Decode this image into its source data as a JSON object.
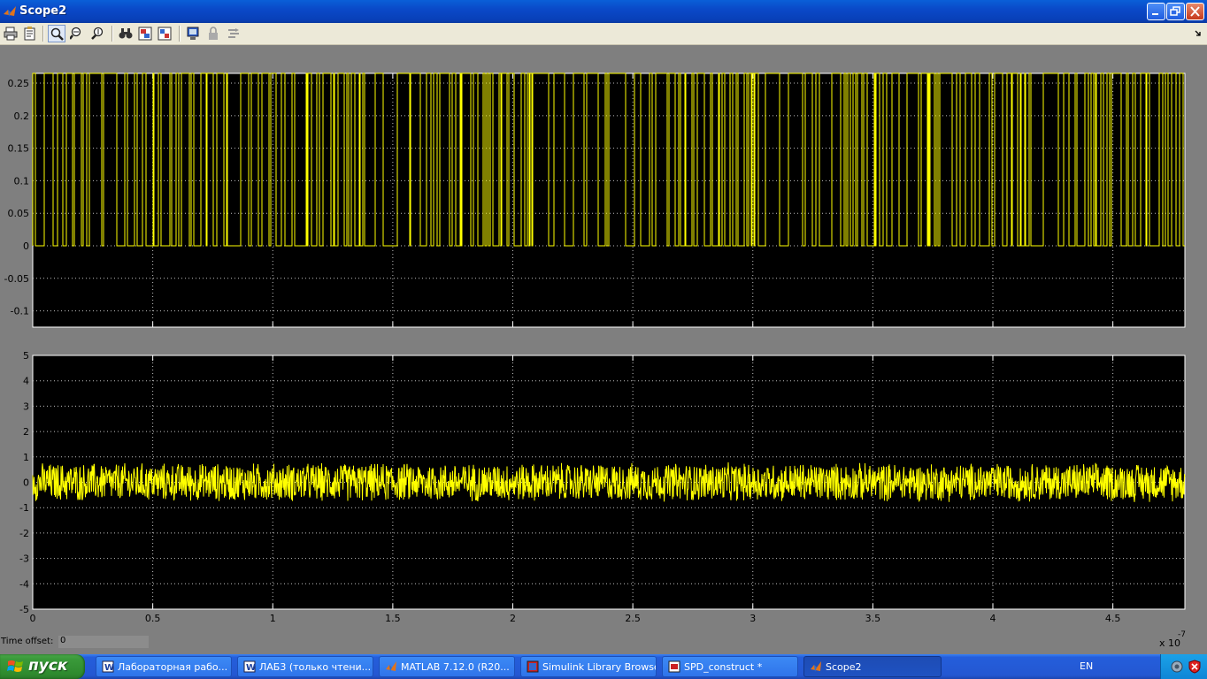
{
  "window": {
    "title": "Scope2"
  },
  "toolbar": {
    "buttons": [
      "print-icon",
      "parameters-icon",
      "zoom-icon",
      "zoom-x-icon",
      "zoom-y-icon",
      "autoscale-icon",
      "save-axes-icon",
      "restore-axes-icon",
      "floating-scope-icon",
      "lock-icon",
      "signal-selection-icon"
    ]
  },
  "chart_data": [
    {
      "type": "line",
      "description_color": "#ffff00",
      "xlim": [
        0,
        4.8e-07
      ],
      "ylim": [
        -0.125,
        0.265
      ],
      "xticks": [
        "0",
        "0.5",
        "1",
        "1.5",
        "2",
        "2.5",
        "3",
        "3.5",
        "4",
        "4.5"
      ],
      "yticks": [
        "0.25",
        "0.2",
        "0.15",
        "0.1",
        "0.05",
        "0",
        "-0.05",
        "-0.1"
      ],
      "grid": true,
      "series": [
        {
          "signal": "binary pulse train",
          "low": 0,
          "high": 0.265
        }
      ]
    },
    {
      "type": "line",
      "xlim": [
        0,
        4.8e-07
      ],
      "ylim": [
        -5,
        5
      ],
      "xticks": [
        "0",
        "0.5",
        "1",
        "1.5",
        "2",
        "2.5",
        "3",
        "3.5",
        "4",
        "4.5"
      ],
      "yticks": [
        "5",
        "4",
        "3",
        "2",
        "1",
        "0",
        "-1",
        "-2",
        "-3",
        "-4",
        "-5"
      ],
      "grid": true,
      "series": [
        {
          "signal": "noise",
          "mean": 0,
          "amplitude": 0.7
        }
      ]
    }
  ],
  "axis": {
    "exponent_base": "x 10",
    "exponent_power": "-7"
  },
  "time_offset": {
    "label": "Time offset:",
    "value": "0"
  },
  "taskbar": {
    "start_label": "пуск",
    "tasks": [
      {
        "label": "Лабораторная рабо...",
        "icon": "word-icon"
      },
      {
        "label": "ЛАБ3 (только чтени...",
        "icon": "word-icon"
      },
      {
        "label": "MATLAB  7.12.0 (R20...",
        "icon": "matlab-icon"
      },
      {
        "label": "Simulink Library Browser",
        "icon": "simulink-icon"
      },
      {
        "label": "SPD_construct *",
        "icon": "simulink-model-icon"
      },
      {
        "label": "Scope2",
        "icon": "matlab-icon",
        "active": true
      }
    ],
    "language": "EN"
  },
  "colors": {
    "signal": "#ffff00",
    "plot_bg": "#000000",
    "figure_bg": "#808080"
  }
}
